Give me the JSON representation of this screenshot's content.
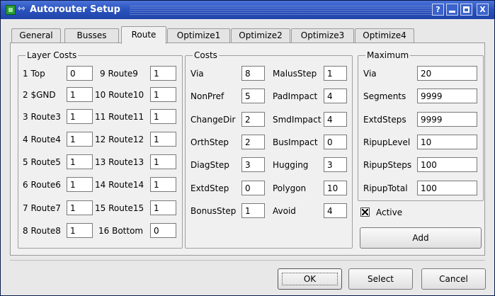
{
  "window": {
    "title": "Autorouter Setup",
    "title_buttons": {
      "help": "?",
      "close": "X"
    }
  },
  "tabs": [
    {
      "label": "General"
    },
    {
      "label": "Busses"
    },
    {
      "label": "Route",
      "active": true
    },
    {
      "label": "Optimize1"
    },
    {
      "label": "Optimize2"
    },
    {
      "label": "Optimize3"
    },
    {
      "label": "Optimize4"
    }
  ],
  "layer_costs": {
    "title": "Layer Costs",
    "left": [
      {
        "label": "1 Top",
        "value": "0"
      },
      {
        "label": "2 $GND",
        "value": "1"
      },
      {
        "label": "3 Route3",
        "value": "1"
      },
      {
        "label": "4 Route4",
        "value": "1"
      },
      {
        "label": "5 Route5",
        "value": "1"
      },
      {
        "label": "6 Route6",
        "value": "1"
      },
      {
        "label": "7 Route7",
        "value": "1"
      },
      {
        "label": "8 Route8",
        "value": "1"
      }
    ],
    "right": [
      {
        "label": "9 Route9",
        "value": "1"
      },
      {
        "label": "10 Route10",
        "value": "1"
      },
      {
        "label": "11 Route11",
        "value": "1"
      },
      {
        "label": "12 Route12",
        "value": "1"
      },
      {
        "label": "13 Route13",
        "value": "1"
      },
      {
        "label": "14 Route14",
        "value": "1"
      },
      {
        "label": "15 Route15",
        "value": "1"
      },
      {
        "label": "16 Bottom",
        "value": "0"
      }
    ]
  },
  "costs": {
    "title": "Costs",
    "left": [
      {
        "label": "Via",
        "value": "8"
      },
      {
        "label": "NonPref",
        "value": "5"
      },
      {
        "label": "ChangeDir",
        "value": "2"
      },
      {
        "label": "OrthStep",
        "value": "2"
      },
      {
        "label": "DiagStep",
        "value": "3"
      },
      {
        "label": "ExtdStep",
        "value": "0"
      },
      {
        "label": "BonusStep",
        "value": "1"
      }
    ],
    "right": [
      {
        "label": "MalusStep",
        "value": "1"
      },
      {
        "label": "PadImpact",
        "value": "4"
      },
      {
        "label": "SmdImpact",
        "value": "4"
      },
      {
        "label": "BusImpact",
        "value": "0"
      },
      {
        "label": "Hugging",
        "value": "3"
      },
      {
        "label": "Polygon",
        "value": "10"
      },
      {
        "label": "Avoid",
        "value": "4"
      }
    ]
  },
  "maximum": {
    "title": "Maximum",
    "rows": [
      {
        "label": "Via",
        "value": "20"
      },
      {
        "label": "Segments",
        "value": "9999"
      },
      {
        "label": "ExtdSteps",
        "value": "9999"
      },
      {
        "label": "RipupLevel",
        "value": "10"
      },
      {
        "label": "RipupSteps",
        "value": "100"
      },
      {
        "label": "RipupTotal",
        "value": "100"
      }
    ]
  },
  "active": {
    "label": "Active",
    "checked": true
  },
  "buttons": {
    "add": "Add",
    "ok": "OK",
    "select": "Select",
    "cancel": "Cancel"
  },
  "colors": {
    "titlebar": "#2c54c0",
    "dialog_background": "#f0f0f0"
  }
}
